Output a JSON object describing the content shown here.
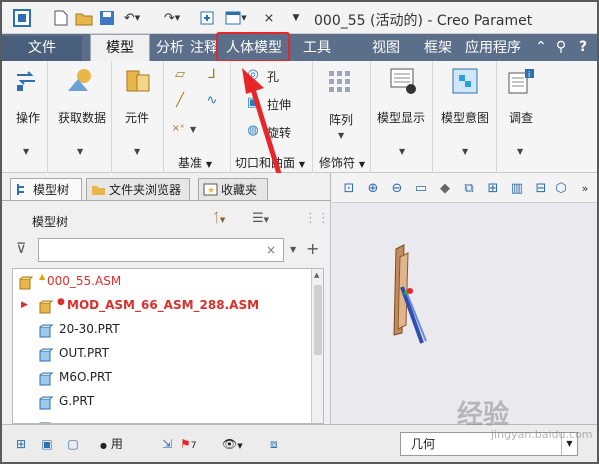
{
  "window": {
    "title": "000_55 (活动的) - Creo Paramet",
    "quick_access": [
      "new",
      "open",
      "save",
      "undo",
      "redo",
      "regenerate",
      "windows",
      "close"
    ]
  },
  "ribbon_tabs": [
    {
      "label": "文件"
    },
    {
      "label": "模型",
      "active": true
    },
    {
      "label": "分析"
    },
    {
      "label": "注释"
    },
    {
      "label": "人体模型",
      "highlighted": true
    },
    {
      "label": "工具"
    },
    {
      "label": "视图"
    },
    {
      "label": "框架"
    },
    {
      "label": "应用程序"
    }
  ],
  "ribbon": {
    "ops_label": "操作",
    "get_data_label": "获取数据",
    "component_label": "元件",
    "datum_group_label": "基准",
    "cut_surface_group_label": "切口和曲面",
    "hole_label": "孔",
    "extrude_label": "拉伸",
    "revolve_label": "旋转",
    "pattern_label": "阵列",
    "modifier_group_label": "修饰符",
    "model_display_label": "模型显示",
    "model_intent_label": "模型意图",
    "investigate_label": "调查"
  },
  "left_panel": {
    "tabs": [
      {
        "label": "模型树",
        "active": true
      },
      {
        "label": "文件夹浏览器"
      },
      {
        "label": "收藏夹"
      }
    ],
    "tree_title": "模型树",
    "filter_placeholder": "",
    "tree_items": [
      {
        "label": "000_55.ASM"
      },
      {
        "label": "MOD_ASM_66_ASM_288.ASM"
      },
      {
        "label": "20-30.PRT"
      },
      {
        "label": "OUT.PRT"
      },
      {
        "label": "M6O.PRT"
      },
      {
        "label": "G.PRT"
      }
    ]
  },
  "status_bar": {
    "use_label": "用",
    "flag_count": "7",
    "filter_select_value": "几何"
  },
  "watermark": {
    "text": "经验",
    "sub": "jingyan.baidu.com"
  },
  "colors": {
    "tab_bar": "#5b6f8a",
    "highlight": "#e8262a",
    "error_text": "#d9302c"
  }
}
